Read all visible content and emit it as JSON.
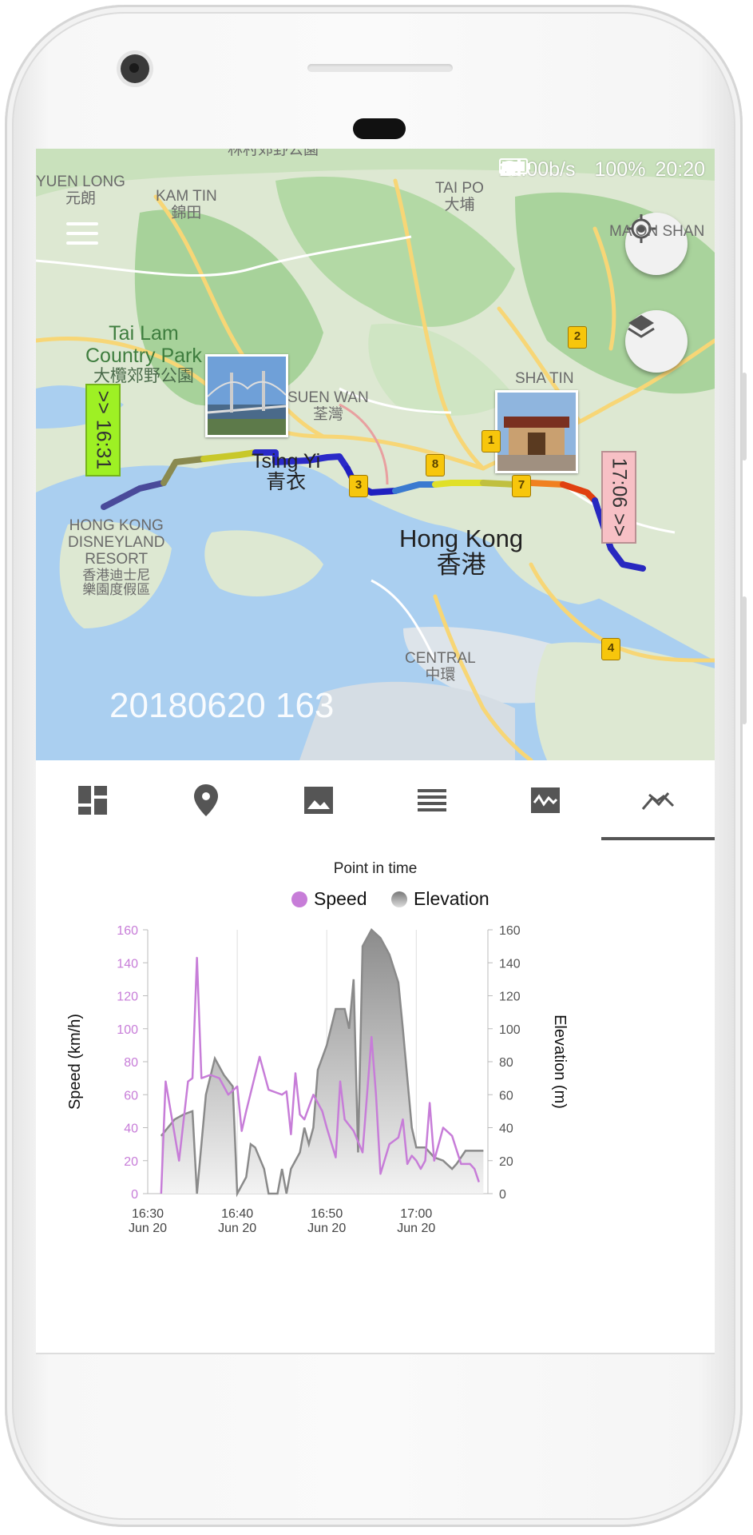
{
  "status_bar": {
    "speed": "10.00b/s",
    "battery": "100%",
    "time": "20:20"
  },
  "map": {
    "labels": {
      "yuen_long": "YUEN LONG",
      "yuen_long_zh": "元朗",
      "kam_tin": "KAM TIN",
      "kam_tin_zh": "錦田",
      "tai_po": "TAI PO",
      "tai_po_zh": "大埔",
      "ma_on_shan": "MA ON SHAN",
      "tai_lam": "Tai Lam",
      "country_park": "Country Park",
      "tai_lam_zh": "大欖郊野公園",
      "suen_wan": "SUEN WAN",
      "suen_wan_zh": "荃灣",
      "sha_tin": "SHA TIN",
      "tsing_yi": "Tsing Yi",
      "tsing_yi_zh": "青衣",
      "hong_kong": "Hong Kong",
      "hong_kong_zh": "香港",
      "disney_1": "HONG KONG",
      "disney_2": "DISNEYLAND",
      "disney_3": "RESORT",
      "disney_zh_1": "香港迪士尼",
      "disney_zh_2": "樂園度假區",
      "central": "CENTRAL",
      "central_zh": "中環",
      "top_park": "林村郊野公園"
    },
    "track_name": "20180620 163",
    "start_flag": ">> 16:31",
    "end_flag": "17:06 >>",
    "markers": [
      "1",
      "2",
      "3",
      "4",
      "7",
      "8"
    ]
  },
  "tabs": [
    {
      "icon": "dashboard-icon"
    },
    {
      "icon": "map-pin-icon"
    },
    {
      "icon": "photo-icon"
    },
    {
      "icon": "list-icon"
    },
    {
      "icon": "chart-wave-icon"
    },
    {
      "icon": "trend-icon",
      "active": true
    }
  ],
  "chart_data": {
    "type": "line",
    "title": "Point in time",
    "legend": [
      "Speed",
      "Elevation"
    ],
    "legend_placement": "top-center",
    "colors": {
      "speed": "#c77dd8",
      "elevation": "#8a8a8a"
    },
    "ylabel_left": "Speed (km/h)",
    "ylabel_right": "Elevation (m)",
    "ylim": [
      0,
      160
    ],
    "y_ticks": [
      "0",
      "20",
      "40",
      "60",
      "80",
      "100",
      "120",
      "140",
      "160"
    ],
    "x_ticks": [
      {
        "minute": 30,
        "time": "16:30",
        "date": "Jun 20"
      },
      {
        "minute": 40,
        "time": "16:40",
        "date": "Jun 20"
      },
      {
        "minute": 50,
        "time": "16:50",
        "date": "Jun 20"
      },
      {
        "minute": 60,
        "time": "17:00",
        "date": "Jun 20"
      }
    ],
    "series": [
      {
        "name": "Speed",
        "points": [
          [
            31.5,
            0
          ],
          [
            32,
            68
          ],
          [
            33.5,
            20
          ],
          [
            34.5,
            68
          ],
          [
            35,
            70
          ],
          [
            35.5,
            143
          ],
          [
            36,
            70
          ],
          [
            37,
            72
          ],
          [
            38,
            70
          ],
          [
            39,
            60
          ],
          [
            40,
            65
          ],
          [
            40.5,
            38
          ],
          [
            41,
            50
          ],
          [
            42.5,
            83
          ],
          [
            43.5,
            63
          ],
          [
            45,
            60
          ],
          [
            45.5,
            62
          ],
          [
            46,
            36
          ],
          [
            46.5,
            73
          ],
          [
            47,
            48
          ],
          [
            47.5,
            45
          ],
          [
            48.5,
            60
          ],
          [
            49.5,
            50
          ],
          [
            50,
            40
          ],
          [
            51,
            22
          ],
          [
            51.5,
            68
          ],
          [
            52,
            45
          ],
          [
            53,
            38
          ],
          [
            54,
            25
          ],
          [
            55,
            95
          ],
          [
            55.5,
            60
          ],
          [
            56,
            12
          ],
          [
            57,
            30
          ],
          [
            58,
            34
          ],
          [
            58.5,
            45
          ],
          [
            59,
            18
          ],
          [
            59.5,
            23
          ],
          [
            60,
            20
          ],
          [
            60.5,
            15
          ],
          [
            61,
            20
          ],
          [
            61.5,
            55
          ],
          [
            62,
            20
          ],
          [
            63,
            40
          ],
          [
            64,
            35
          ],
          [
            65,
            18
          ],
          [
            66,
            18
          ],
          [
            66.5,
            15
          ],
          [
            67,
            7
          ]
        ]
      },
      {
        "name": "Elevation",
        "points": [
          [
            31.5,
            35
          ],
          [
            33,
            45
          ],
          [
            34,
            48
          ],
          [
            35,
            50
          ],
          [
            35.5,
            0
          ],
          [
            36.5,
            60
          ],
          [
            37.5,
            82
          ],
          [
            38.5,
            72
          ],
          [
            39.5,
            65
          ],
          [
            40,
            0
          ],
          [
            41,
            10
          ],
          [
            41.5,
            30
          ],
          [
            42,
            28
          ],
          [
            43,
            15
          ],
          [
            43.5,
            0
          ],
          [
            44.5,
            0
          ],
          [
            45,
            15
          ],
          [
            45.5,
            0
          ],
          [
            46,
            15
          ],
          [
            47,
            25
          ],
          [
            47.5,
            40
          ],
          [
            48,
            30
          ],
          [
            48.5,
            40
          ],
          [
            49,
            75
          ],
          [
            50,
            90
          ],
          [
            51,
            112
          ],
          [
            52,
            112
          ],
          [
            52.5,
            100
          ],
          [
            53,
            130
          ],
          [
            53.5,
            25
          ],
          [
            54,
            150
          ],
          [
            55,
            160
          ],
          [
            56,
            155
          ],
          [
            57,
            145
          ],
          [
            58,
            128
          ],
          [
            58.5,
            100
          ],
          [
            59,
            70
          ],
          [
            59.5,
            40
          ],
          [
            60,
            28
          ],
          [
            61,
            28
          ],
          [
            62,
            22
          ],
          [
            63,
            20
          ],
          [
            64,
            15
          ],
          [
            64.5,
            18
          ],
          [
            65.5,
            26
          ],
          [
            66.5,
            26
          ],
          [
            67.5,
            26
          ]
        ]
      }
    ]
  }
}
